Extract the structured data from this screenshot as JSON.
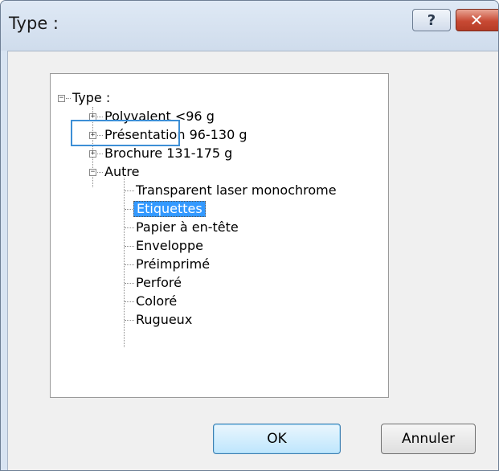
{
  "window": {
    "title": "Type :",
    "help_glyph": "?",
    "close_glyph": "✕"
  },
  "tree": {
    "root": {
      "label": "Type :",
      "expander": "−"
    },
    "groups": [
      {
        "label": "Polyvalent <96 g",
        "expander": "+"
      },
      {
        "label": "Présentation 96-130 g",
        "expander": "+"
      },
      {
        "label": "Brochure 131-175 g",
        "expander": "+"
      },
      {
        "label": "Autre",
        "expander": "−"
      }
    ],
    "autre_items": [
      {
        "label": "Transparent laser monochrome"
      },
      {
        "label": "Etiquettes",
        "selected": true
      },
      {
        "label": "Papier à en-tête"
      },
      {
        "label": "Enveloppe"
      },
      {
        "label": "Préimprimé"
      },
      {
        "label": "Perforé"
      },
      {
        "label": "Coloré"
      },
      {
        "label": "Rugueux"
      }
    ]
  },
  "buttons": {
    "ok": "OK",
    "cancel": "Annuler"
  },
  "colors": {
    "selection": "#3399ff",
    "focus_frame": "#3d8fd6",
    "close_button": "#c84a34"
  }
}
